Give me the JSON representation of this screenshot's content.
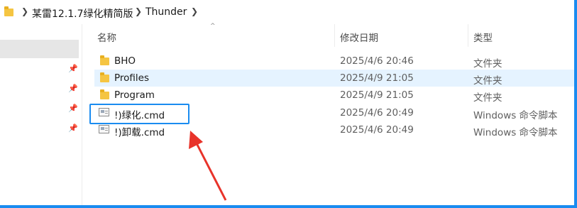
{
  "breadcrumb": {
    "items": [
      {
        "label": "某雷12.1.7绿化精简版"
      },
      {
        "label": "Thunder"
      }
    ]
  },
  "columns": {
    "name": "名称",
    "date": "修改日期",
    "type": "类型"
  },
  "files": [
    {
      "name": "BHO",
      "date": "2025/4/6 20:46",
      "type": "文件夹",
      "icon": "folder-icon"
    },
    {
      "name": "Profiles",
      "date": "2025/4/9 21:05",
      "type": "文件夹",
      "icon": "folder-icon"
    },
    {
      "name": "Program",
      "date": "2025/4/9 21:05",
      "type": "文件夹",
      "icon": "folder-icon"
    },
    {
      "name": "!)绿化.cmd",
      "date": "2025/4/6 20:49",
      "type": "Windows 命令脚本",
      "icon": "cmd-script-icon"
    },
    {
      "name": "!)卸载.cmd",
      "date": "2025/4/6 20:49",
      "type": "Windows 命令脚本",
      "icon": "cmd-script-icon"
    }
  ],
  "colors": {
    "annotation_blue": "#1a8cf0",
    "annotation_red": "#e8332a",
    "hover_row": "#e5f3ff"
  }
}
